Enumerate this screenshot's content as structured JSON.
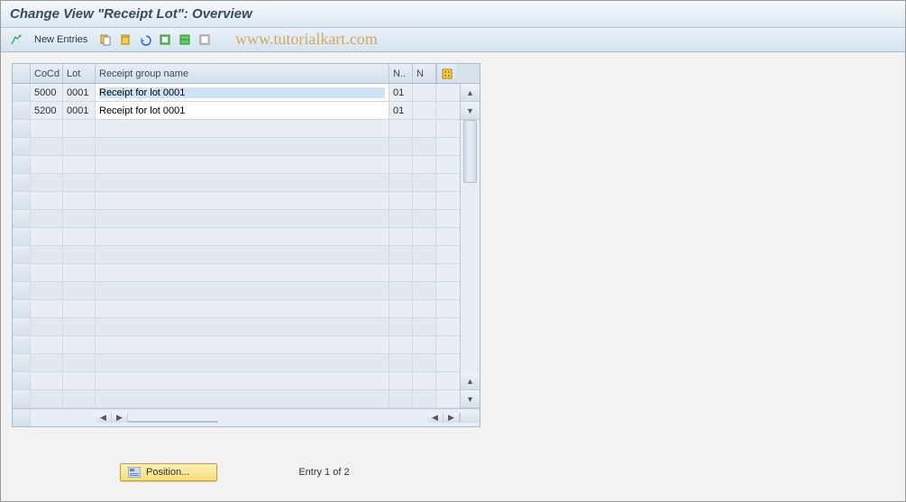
{
  "title": "Change View \"Receipt Lot\": Overview",
  "watermark": "www.tutorialkart.com",
  "toolbar": {
    "new_entries": "New Entries"
  },
  "grid": {
    "headers": {
      "cocd": "CoCd",
      "lot": "Lot",
      "name": "Receipt group name",
      "n1": "N..",
      "n2": "N"
    },
    "rows": [
      {
        "cocd": "5000",
        "lot": "0001",
        "name": "Receipt for lot 0001",
        "n1": "01",
        "n2": "",
        "highlighted": true
      },
      {
        "cocd": "5200",
        "lot": "0001",
        "name": "Receipt for lot 0001",
        "n1": "01",
        "n2": "",
        "highlighted": false
      }
    ],
    "empty_rows": 16
  },
  "footer": {
    "position_label": "Position...",
    "entry_label": "Entry 1 of 2"
  }
}
